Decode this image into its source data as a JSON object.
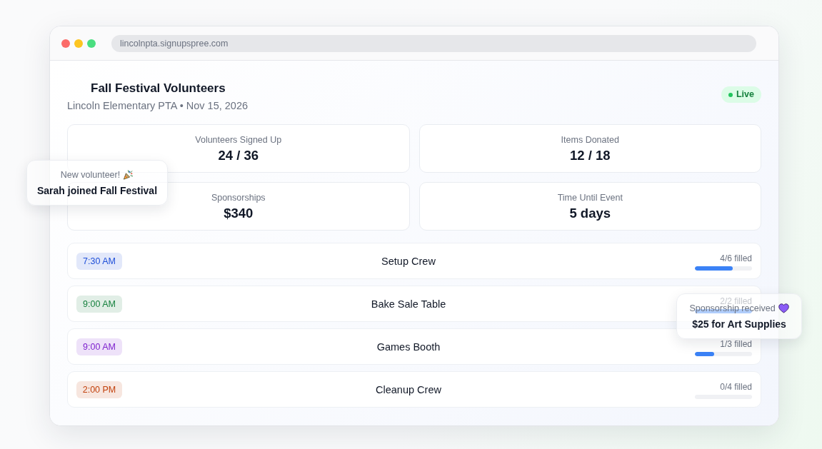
{
  "browser": {
    "url": "lincolnpta.signupspree.com"
  },
  "event": {
    "title": "Fall Festival Volunteers",
    "subtitle": "Lincoln Elementary PTA • Nov 15, 2026",
    "status": "Live"
  },
  "stats": [
    {
      "label": "Volunteers Signed Up",
      "value": "24 / 36"
    },
    {
      "label": "Items Donated",
      "value": "12 / 18"
    },
    {
      "label": "Sponsorships",
      "value": "$340"
    },
    {
      "label": "Time Until Event",
      "value": "5 days"
    }
  ],
  "slots": [
    {
      "time": "7:30 AM",
      "color": "#1d4ed8",
      "name": "Setup Crew",
      "filled": "4/6 filled",
      "level": 0.667
    },
    {
      "time": "9:00 AM",
      "color": "#15803d",
      "name": "Bake Sale Table",
      "filled": "2/2 filled",
      "level": 1
    },
    {
      "time": "9:00 AM",
      "color": "#7e22ce",
      "name": "Games Booth",
      "filled": "1/3 filled",
      "level": 0.333
    },
    {
      "time": "2:00 PM",
      "color": "#c2410c",
      "name": "Cleanup Crew",
      "filled": "0/4 filled"
    }
  ],
  "toasts": [
    {
      "kind": "party",
      "title": "New volunteer!",
      "message": "Sarah joined Fall Festival"
    },
    {
      "kind": "heart",
      "title": "Sponsorship received",
      "message": "$25 for Art Supplies"
    }
  ]
}
